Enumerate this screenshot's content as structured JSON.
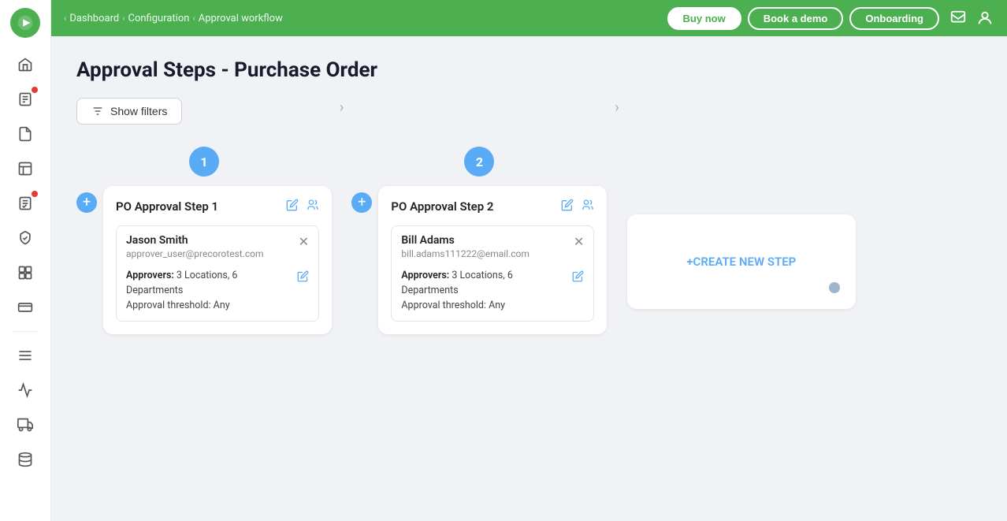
{
  "sidebar": {
    "icons": [
      {
        "name": "home-icon",
        "symbol": "⌂"
      },
      {
        "name": "list-icon",
        "symbol": "☰"
      },
      {
        "name": "document-icon",
        "symbol": "📄"
      },
      {
        "name": "clipboard-icon",
        "symbol": "📋"
      },
      {
        "name": "checklist-icon",
        "symbol": "✔"
      },
      {
        "name": "shield-icon",
        "symbol": "🛡"
      },
      {
        "name": "box-icon",
        "symbol": "📦"
      },
      {
        "name": "credit-card-icon",
        "symbol": "💳"
      },
      {
        "name": "menu-icon",
        "symbol": "≡"
      },
      {
        "name": "chart-icon",
        "symbol": "📊"
      },
      {
        "name": "truck-icon",
        "symbol": "🚚"
      },
      {
        "name": "storage-icon",
        "symbol": "🗄"
      }
    ]
  },
  "topnav": {
    "breadcrumbs": [
      {
        "label": "Dashboard",
        "sep": false
      },
      {
        "label": "Configuration",
        "sep": true
      },
      {
        "label": "Approval workflow",
        "sep": true
      }
    ],
    "buttons": [
      {
        "label": "Buy now",
        "active": true
      },
      {
        "label": "Book a demo",
        "active": false
      },
      {
        "label": "Onboarding",
        "active": false
      }
    ]
  },
  "page": {
    "title": "Approval Steps - Purchase Order",
    "show_filters_label": "Show filters"
  },
  "steps": [
    {
      "number": "1",
      "title": "PO Approval Step 1",
      "approver_name": "Jason Smith",
      "approver_email": "approver_user@precorotest.com",
      "approvers_text": "3 Locations, 6 Departments",
      "threshold": "Any"
    },
    {
      "number": "2",
      "title": "PO Approval Step 2",
      "approver_name": "Bill Adams",
      "approver_email": "bill.adams111222@email.com",
      "approvers_text": "3 Locations, 6 Departments",
      "threshold": "Any"
    }
  ],
  "labels": {
    "approvers": "Approvers:",
    "threshold": "Approval threshold:",
    "create_new": "+CREATE NEW STEP"
  }
}
